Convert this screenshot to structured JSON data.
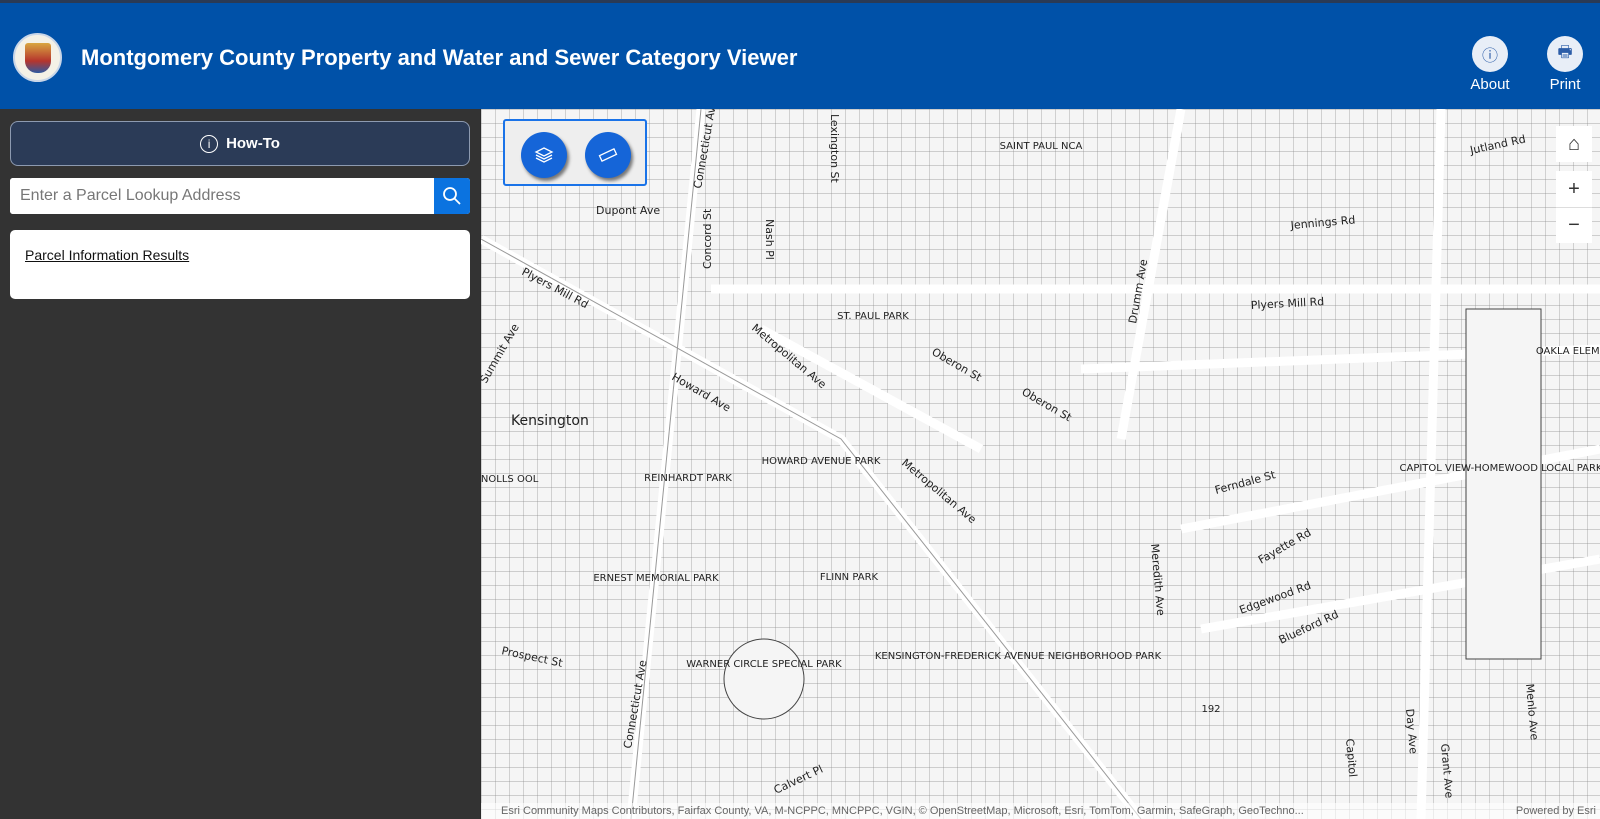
{
  "header": {
    "title": "Montgomery County Property and Water and Sewer Category Viewer",
    "about_label": "About",
    "print_label": "Print"
  },
  "sidebar": {
    "howto_label": "How-To",
    "search_placeholder": "Enter a Parcel Lookup Address",
    "results_title": "Parcel Information Results"
  },
  "map": {
    "streets": [
      "Plyers Mill Rd",
      "Dupont Ave",
      "Concord St",
      "Nash Pl",
      "Connecticut Ave",
      "Lexington St",
      "Metropolitan Ave",
      "Howard Ave",
      "Summit Ave",
      "Oberon St",
      "Drumm Ave",
      "Jennings Rd",
      "Jutland Rd",
      "Ferndale St",
      "Fayette Rd",
      "Edgewood Rd",
      "Blueford Rd",
      "Meredith Ave",
      "Prospect St",
      "Calvert Pl",
      "Day Ave",
      "Grant Ave",
      "Menlo Ave",
      "Capitol"
    ],
    "places": [
      "Kensington",
      "SAINT PAUL NCA",
      "ST. PAUL PARK",
      "HOWARD AVENUE PARK",
      "REINHARDT PARK",
      "ERNEST MEMORIAL PARK",
      "FLINN PARK",
      "WARNER CIRCLE SPECIAL PARK",
      "KENSINGTON-FREDERICK AVENUE NEIGHBORHOOD PARK",
      "CAPITOL VIEW-HOMEWOOD LOCAL PARK",
      "N KNOLLS OOL",
      "OAKLA ELEM SC",
      "192"
    ],
    "attribution": "Esri Community Maps Contributors, Fairfax County, VA, M-NCPPC, MNCPPC, VGIN, © OpenStreetMap, Microsoft, Esri, TomTom, Garmin, SafeGraph, GeoTechno...",
    "powered_by": "Powered by Esri"
  }
}
